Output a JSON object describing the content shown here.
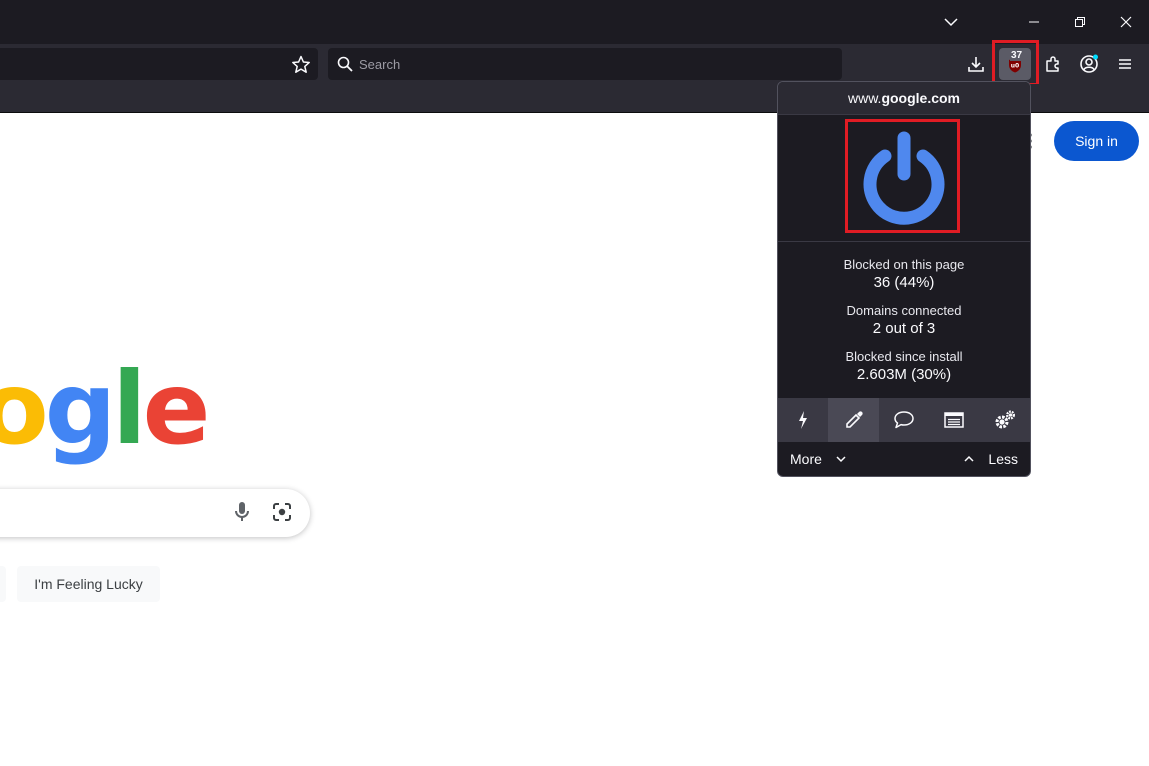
{
  "browser": {
    "search_placeholder": "Search",
    "toolbar_icons": [
      "bookmark-star-icon",
      "search-icon",
      "download-icon",
      "ublock-origin-icon",
      "extensions-icon",
      "account-icon",
      "menu-icon"
    ],
    "window_controls": [
      "list-all-tabs-icon",
      "minimize-icon",
      "restore-icon",
      "close-icon"
    ]
  },
  "ublock_badge": "37",
  "popup": {
    "hostname_prefix": "www.",
    "hostname_main": "google.com",
    "stats": [
      {
        "label": "Blocked on this page",
        "value": "36 (44%)"
      },
      {
        "label": "Domains connected",
        "value": "2 out of 3"
      },
      {
        "label": "Blocked since install",
        "value": "2.603M (30%)"
      }
    ],
    "tools": [
      "lightning-icon",
      "eyedropper-icon",
      "speech-bubble-icon",
      "logger-list-icon",
      "settings-gears-icon"
    ],
    "more_label": "More",
    "less_label": "Less"
  },
  "google": {
    "signin_label": "Sign in",
    "feeling_lucky_label": "I'm Feeling Lucky",
    "logo_letters": [
      "o",
      "g",
      "l",
      "e"
    ],
    "colors": {
      "blue": "#4285f4",
      "red": "#ea4335",
      "yellow": "#fbbc05",
      "green": "#34a853"
    }
  },
  "colors": {
    "highlight": "#e01c24",
    "power_blue": "#4f88ee",
    "signin_blue": "#0b57d0"
  }
}
